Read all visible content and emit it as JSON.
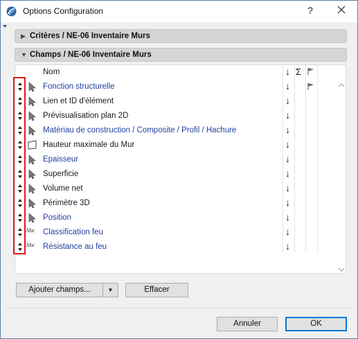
{
  "window": {
    "title": "Options Configuration",
    "help_glyph": "?"
  },
  "sections": [
    {
      "arrow": "▶",
      "label": "Critères / NE-06 Inventaire Murs",
      "expanded": false
    },
    {
      "arrow": "▼",
      "label": "Champs / NE-06 Inventaire Murs",
      "expanded": true
    }
  ],
  "list": {
    "header": {
      "name": "Nom",
      "sort_icon": "↓",
      "sum_icon": "Σ",
      "flag_icon": "flag-icon"
    },
    "rows": [
      {
        "name": "Fonction structurelle",
        "icon": "pointer-arrow-icon",
        "linked": true,
        "sort": "↓",
        "flag": true
      },
      {
        "name": "Lien et ID d'élément",
        "icon": "pointer-arrow-icon",
        "linked": false,
        "sort": "↓",
        "flag": false
      },
      {
        "name": "Prévisualisation plan 2D",
        "icon": "pointer-arrow-icon",
        "linked": false,
        "sort": "↓",
        "flag": false
      },
      {
        "name": "Matériau de construction / Composite / Profil / Hachure",
        "icon": "pointer-arrow-icon",
        "linked": true,
        "sort": "↓",
        "flag": false
      },
      {
        "name": "Hauteur maximale du Mur",
        "icon": "flag-outline-icon",
        "linked": false,
        "sort": "↓",
        "flag": false
      },
      {
        "name": "Epaisseur",
        "icon": "pointer-arrow-icon",
        "linked": true,
        "sort": "↓",
        "flag": false
      },
      {
        "name": "Superficie",
        "icon": "pointer-arrow-icon",
        "linked": false,
        "sort": "↓",
        "flag": false
      },
      {
        "name": "Volume net",
        "icon": "pointer-arrow-icon",
        "linked": false,
        "sort": "↓",
        "flag": false
      },
      {
        "name": "Périmètre 3D",
        "icon": "pointer-arrow-icon",
        "linked": false,
        "sort": "↓",
        "flag": false
      },
      {
        "name": "Position",
        "icon": "pointer-arrow-icon",
        "linked": true,
        "sort": "↓",
        "flag": false
      },
      {
        "name": "Classification feu",
        "icon": "abc-text-icon",
        "icon_text": "Abc",
        "linked": true,
        "sort": "↓",
        "flag": false
      },
      {
        "name": "Résistance au feu",
        "icon": "abc-text-icon",
        "icon_text": "Abc",
        "linked": true,
        "sort": "↓",
        "flag": false
      }
    ]
  },
  "buttons": {
    "add_fields": "Ajouter champs...",
    "add_arrow": "▼",
    "clear": "Effacer",
    "cancel": "Annuler",
    "ok": "OK"
  },
  "colors": {
    "linked_text": "#1f3fa0",
    "highlight_box": "#e01c1c",
    "section_bg": "#d5d5d5",
    "ok_border": "#0078d7"
  }
}
